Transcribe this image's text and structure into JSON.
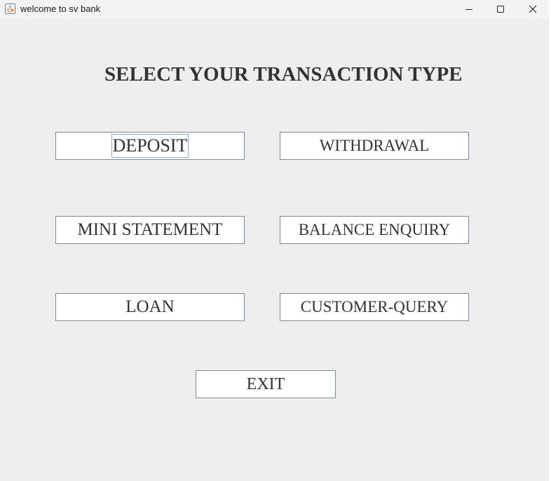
{
  "window": {
    "title": "welcome to sv bank",
    "icon": "java-cup-icon",
    "controls": [
      "minimize-icon",
      "maximize-icon",
      "close-icon"
    ]
  },
  "main": {
    "heading": "SELECT YOUR TRANSACTION TYPE",
    "buttons": {
      "deposit": "DEPOSIT",
      "withdrawal": "WITHDRAWAL",
      "mini_statement": "MINI STATEMENT",
      "balance_enquiry": "BALANCE ENQUIRY",
      "loan": "LOAN",
      "customer_query": "CUSTOMER-QUERY",
      "exit": "EXIT"
    }
  },
  "colors": {
    "background": "#eeeeee",
    "button_fill": "#ffffff",
    "button_border": "#7a8a9a",
    "text": "#333333"
  }
}
